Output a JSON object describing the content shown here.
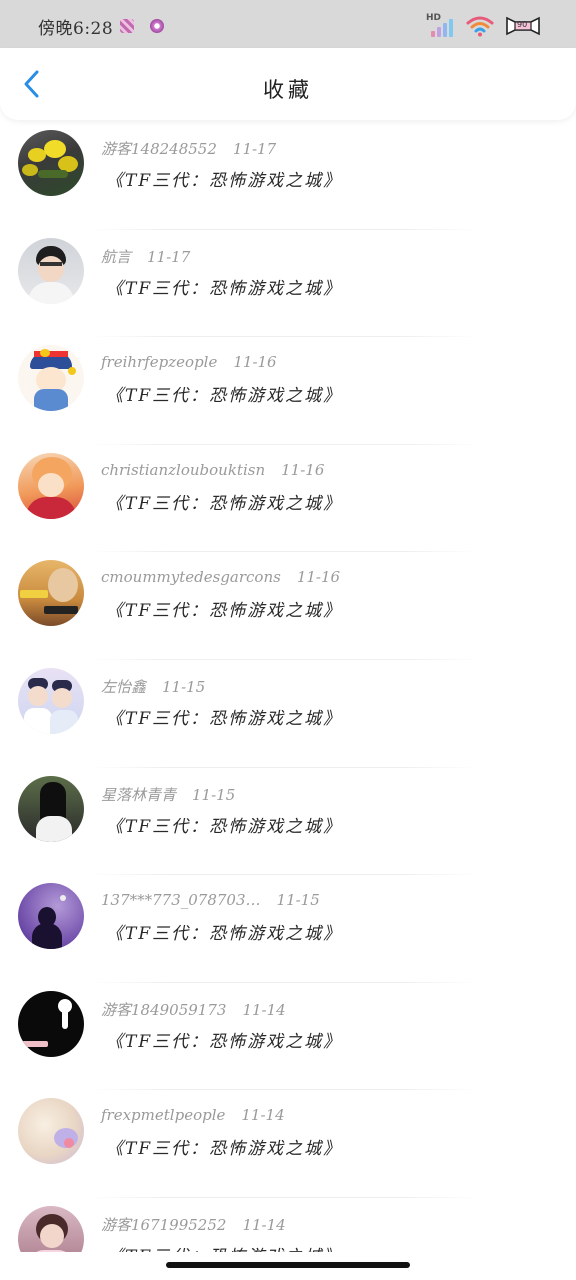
{
  "status_bar": {
    "time": "傍晚6:28",
    "hd_label": "HD",
    "battery_label": "90"
  },
  "header": {
    "back_icon": "chevron-left-icon",
    "title": "收藏"
  },
  "colors": {
    "accent": "#2a8ee6",
    "username": "#9a9a9a",
    "title_text": "#2a2a2a",
    "status_bar_bg": "#d9d9d9"
  },
  "favorites": [
    {
      "username": "游客148248552",
      "date": "11-17",
      "title": "《TF三代：恐怖游戏之城》",
      "avatar": "avatar-yellow-flowers"
    },
    {
      "username": "航言",
      "date": "11-17",
      "title": "《TF三代：恐怖游戏之城》",
      "avatar": "avatar-boy-glasses"
    },
    {
      "username": "freihrfepzeople",
      "date": "11-16",
      "title": "《TF三代：恐怖游戏之城》",
      "avatar": "avatar-cartoon-character"
    },
    {
      "username": "christianzloubouktisn",
      "date": "11-16",
      "title": "《TF三代：恐怖游戏之城》",
      "avatar": "avatar-anime-orange-hair"
    },
    {
      "username": "cmoummytedesgarcons",
      "date": "11-16",
      "title": "《TF三代：恐怖游戏之城》",
      "avatar": "avatar-photo-text"
    },
    {
      "username": "左怡鑫",
      "date": "11-15",
      "title": "《TF三代：恐怖游戏之城》",
      "avatar": "avatar-two-boys"
    },
    {
      "username": "星落林青青",
      "date": "11-15",
      "title": "《TF三代：恐怖游戏之城》",
      "avatar": "avatar-girl-dark-hair"
    },
    {
      "username": "137***773_078703…",
      "date": "11-15",
      "title": "《TF三代：恐怖游戏之城》",
      "avatar": "avatar-purple-silhouette"
    },
    {
      "username": "游客1849059173",
      "date": "11-14",
      "title": "《TF三代：恐怖游戏之城》",
      "avatar": "avatar-black-figure"
    },
    {
      "username": "frexpmetlpeople",
      "date": "11-14",
      "title": "《TF三代：恐怖游戏之城》",
      "avatar": "avatar-pastel-blur"
    },
    {
      "username": "游客1671995252",
      "date": "11-14",
      "title": "《TF三代：恐怖游戏之城》",
      "avatar": "avatar-pink-portrait"
    }
  ]
}
